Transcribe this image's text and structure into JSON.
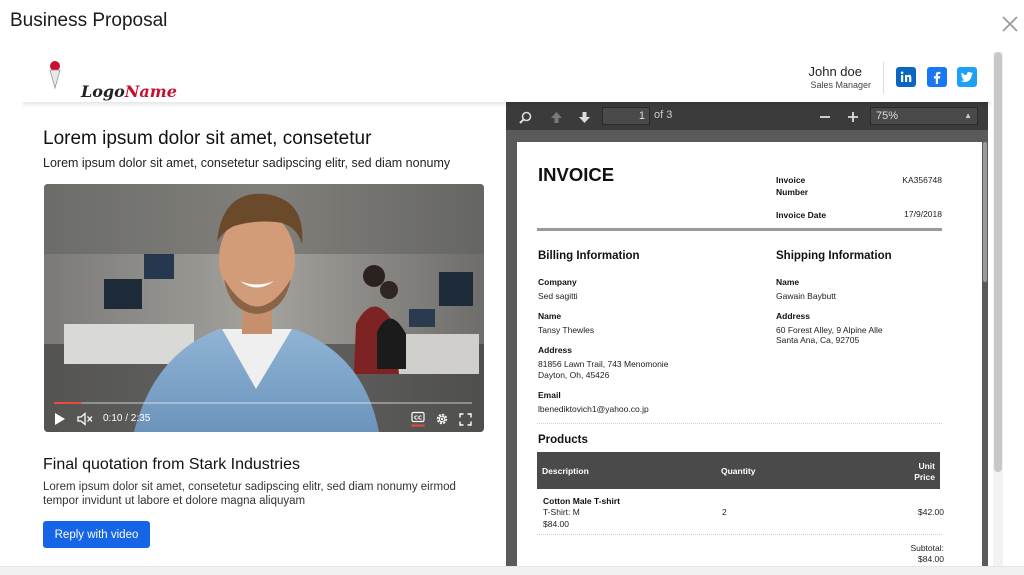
{
  "modal": {
    "title": "Business Proposal"
  },
  "header": {
    "logo": {
      "text_a": "Logo",
      "text_b": "Name"
    },
    "user": {
      "name": "John doe",
      "role": "Sales Manager"
    },
    "social": [
      "linkedin-icon",
      "facebook-icon",
      "twitter-icon"
    ]
  },
  "left": {
    "headline": "Lorem ipsum dolor sit amet, consetetur",
    "subheadline": "Lorem ipsum dolor sit amet, consetetur sadipscing elitr, sed diam nonumy",
    "video": {
      "time": "0:10 / 2:35",
      "progress": 0.065
    },
    "quote_title": "Final quotation from Stark Industries",
    "quote_body": "Lorem ipsum dolor sit amet, consetetur sadipscing elitr, sed diam nonumy eirmod tempor invidunt ut labore et dolore magna aliquyam",
    "reply_label": "Reply with video"
  },
  "pdf_viewer": {
    "page_current": "1",
    "page_of": "of 3",
    "zoom": "75%",
    "invoice": {
      "title": "INVOICE",
      "number_label": "Invoice Number",
      "number_label_1": "Invoice",
      "number_label_2": "Number",
      "number_value": "KA356748",
      "date_label": "Invoice Date",
      "date_value": "17/9/2018",
      "billing": {
        "heading": "Billing Information",
        "company_label": "Company",
        "company_value": "Sed sagitti",
        "name_label": "Name",
        "name_value": "Tansy Thewles",
        "address_label": "Address",
        "address_line1": "81856 Lawn Trail, 743 Menomonie",
        "address_line2": "Dayton, Oh, 45426",
        "email_label": "Email",
        "email_value": "lbenediktovich1@yahoo.co.jp"
      },
      "shipping": {
        "heading": "Shipping Information",
        "name_label": "Name",
        "name_value": "Gawain Baybutt",
        "address_label": "Address",
        "address_line1": "60 Forest Alley, 9 Alpine Alle",
        "address_line2": "Santa Ana, Ca, 92705"
      },
      "products": {
        "heading": "Products",
        "col_description": "Description",
        "col_quantity": "Quantity",
        "col_unit_1": "Unit",
        "col_unit_2": "Price",
        "rows": [
          {
            "name": "Cotton Male T-shirt",
            "detail": "T-Shirt: M",
            "price": "$84.00",
            "quantity": "2",
            "unit_price": "$42.00"
          }
        ],
        "subtotal_label": "Subtotal:",
        "subtotal_value": "$84.00"
      }
    }
  },
  "colors": {
    "accent": "#1565e6",
    "linkedin": "#0a66c2",
    "facebook": "#1877f2",
    "twitter": "#1da1f2",
    "progress": "#e74c3c"
  }
}
